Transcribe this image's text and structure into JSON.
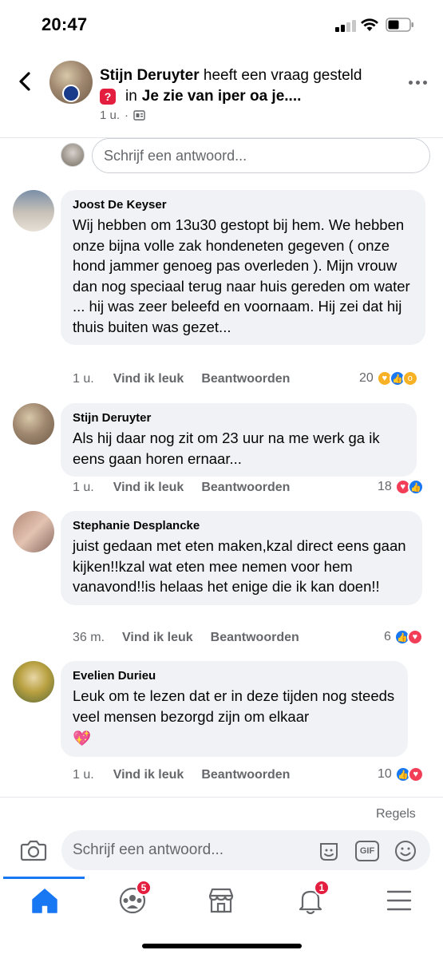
{
  "status_bar": {
    "time": "20:47"
  },
  "header": {
    "author": "Stijn Deruyter",
    "action_text": " heeft een vraag gesteld",
    "in_text": "in",
    "group": "Je zie van iper oa je....",
    "age": "1 u.",
    "separator": "·"
  },
  "reply_top": {
    "placeholder": "Schrijf een antwoord..."
  },
  "comments": [
    {
      "name": "Joost De Keyser",
      "text": "Wij hebben om 13u30 gestopt bij hem. We hebben onze bijna volle zak hondeneten gegeven ( onze hond jammer genoeg pas overleden ). Mijn vrouw dan nog speciaal terug naar huis gereden om water ... hij was zeer beleefd en voornaam. Hij zei dat hij thuis buiten was gezet...",
      "age": "1 u.",
      "like": "Vind ik leuk",
      "reply": "Beantwoorden",
      "reaction_count": "20"
    },
    {
      "name": "Stijn Deruyter",
      "text": "Als hij daar nog zit om 23 uur na me werk ga ik eens gaan horen ernaar...",
      "age": "1 u.",
      "like": "Vind ik leuk",
      "reply": "Beantwoorden",
      "reaction_count": "18"
    },
    {
      "name": "Stephanie Desplancke",
      "text": "juist gedaan met eten maken,kzal direct eens gaan kijken!!kzal wat eten mee nemen voor hem vanavond!!is helaas het enige die ik kan doen!!",
      "age": "36 m.",
      "like": "Vind ik leuk",
      "reply": "Beantwoorden",
      "reaction_count": "6"
    },
    {
      "name": "Evelien Durieu",
      "text": "Leuk om te lezen dat er in deze tijden nog steeds veel mensen bezorgd zijn om elkaar",
      "emoji": "💖",
      "age": "1 u.",
      "like": "Vind ik leuk",
      "reply": "Beantwoorden",
      "reaction_count": "10"
    }
  ],
  "regels": "Regels",
  "composer": {
    "placeholder": "Schrijf een antwoord...",
    "gif_label": "GIF"
  },
  "tabbar": {
    "groups_badge": "5",
    "notifications_badge": "1"
  },
  "colors": {
    "accent": "#1877f2",
    "badge": "#e41e3f",
    "bubble": "#f0f2f5",
    "muted": "#65676b"
  }
}
